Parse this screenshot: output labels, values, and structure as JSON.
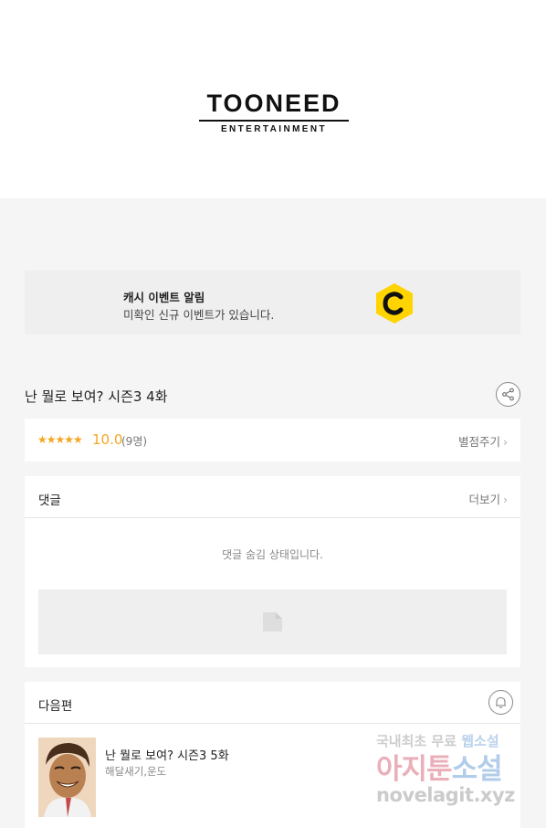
{
  "banner": {
    "logo_main": "TOONEED",
    "logo_sub": "ENTERTAINMENT"
  },
  "event": {
    "title": "캐시 이벤트 알림",
    "description": "미확인 신규 이벤트가 있습니다.",
    "coin_letter": "C",
    "coin_color": "#ffd400"
  },
  "episode": {
    "title": "난 뭘로 보여? 시즌3 4화",
    "share_icon": "share-icon"
  },
  "rating": {
    "stars": "★★★★★",
    "score": "10.0",
    "count": "(9명)",
    "rate_label": "별점주기"
  },
  "comments": {
    "title": "댓글",
    "more_label": "더보기",
    "hidden_message": "댓글 숨김 상태입니다."
  },
  "next_episode": {
    "section_title": "다음편",
    "title": "난 뭘로 보여? 시즌3 5화",
    "authors": "해달새기,운도",
    "bell_icon": "bell-icon"
  },
  "watermark": {
    "line1_a": "국내최초 무료 ",
    "line1_b": "웹소설",
    "line2_a": "아지툰",
    "line2_b": "소설",
    "line3": "novelagit.xyz"
  },
  "colors": {
    "accent_orange": "#f5a623",
    "background": "#f5f5f5"
  }
}
